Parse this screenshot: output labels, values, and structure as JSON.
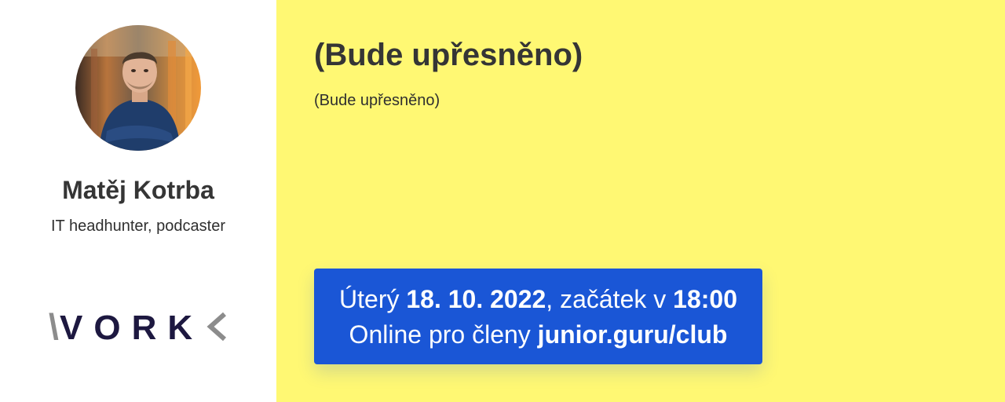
{
  "speaker": {
    "name": "Matěj Kotrba",
    "role": "IT headhunter, podcaster"
  },
  "company": {
    "logo_text": "VORK"
  },
  "event": {
    "title": "(Bude upřesněno)",
    "description": "(Bude upřesněno)"
  },
  "schedule": {
    "day": "Úterý",
    "date": "18. 10. 2022",
    "start_label": ", začátek v",
    "time": "18:00",
    "location_label": "Online pro členy",
    "url": "junior.guru/club"
  },
  "colors": {
    "left_panel": "#ffffff",
    "right_panel": "#fff873",
    "box": "#1a56d6",
    "logo_dark": "#1d1840",
    "logo_gray": "#8c8c8c"
  }
}
